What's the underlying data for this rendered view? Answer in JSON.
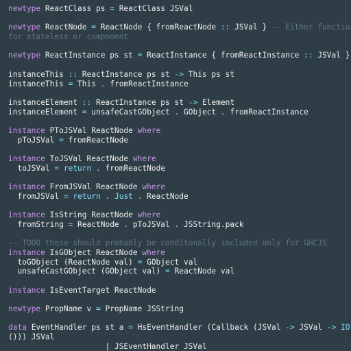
{
  "editor": {
    "colors": {
      "background": "#2f3e46",
      "keyword": "#c792ea",
      "operator": "#89ddff",
      "comment": "#5f7580",
      "text": "#eeeeee"
    },
    "lines": [
      [
        {
          "t": "newtype",
          "c": "kw"
        },
        {
          "t": " ReactClass ps ",
          "c": "tx"
        },
        {
          "t": "=",
          "c": "op"
        },
        {
          "t": " ReactClass JSVal",
          "c": "tx"
        }
      ],
      [],
      [
        {
          "t": "newtype",
          "c": "kw"
        },
        {
          "t": " ReactNode ",
          "c": "tx"
        },
        {
          "t": "=",
          "c": "op"
        },
        {
          "t": " ReactNode { fromReactNode ",
          "c": "tx"
        },
        {
          "t": "::",
          "c": "op"
        },
        {
          "t": " JSVal } ",
          "c": "tx"
        },
        {
          "t": "-- Either function",
          "c": "cm"
        }
      ],
      [
        {
          "t": "for stateless or component",
          "c": "cm"
        }
      ],
      [],
      [
        {
          "t": "newtype",
          "c": "kw"
        },
        {
          "t": " ReactInstance ps st ",
          "c": "tx"
        },
        {
          "t": "=",
          "c": "op"
        },
        {
          "t": " ReactInstance { fromReactInstance ",
          "c": "tx"
        },
        {
          "t": "::",
          "c": "op"
        },
        {
          "t": " JSVal }",
          "c": "tx"
        }
      ],
      [],
      [
        {
          "t": "instanceThis ",
          "c": "tx"
        },
        {
          "t": "::",
          "c": "op"
        },
        {
          "t": " ReactInstance ps st ",
          "c": "tx"
        },
        {
          "t": "->",
          "c": "op"
        },
        {
          "t": " This ps st",
          "c": "tx"
        }
      ],
      [
        {
          "t": "instanceThis ",
          "c": "tx"
        },
        {
          "t": "=",
          "c": "op"
        },
        {
          "t": " This ",
          "c": "tx"
        },
        {
          "t": ".",
          "c": "op"
        },
        {
          "t": " fromReactInstance",
          "c": "tx"
        }
      ],
      [],
      [
        {
          "t": "instanceElement ",
          "c": "tx"
        },
        {
          "t": "::",
          "c": "op"
        },
        {
          "t": " ReactInstance ps st ",
          "c": "tx"
        },
        {
          "t": "->",
          "c": "op"
        },
        {
          "t": " Element",
          "c": "tx"
        }
      ],
      [
        {
          "t": "instanceElement ",
          "c": "tx"
        },
        {
          "t": "=",
          "c": "op"
        },
        {
          "t": " unsafeCastGObject ",
          "c": "tx"
        },
        {
          "t": ".",
          "c": "op"
        },
        {
          "t": " GObject ",
          "c": "tx"
        },
        {
          "t": ".",
          "c": "op"
        },
        {
          "t": " fromReactInstance",
          "c": "tx"
        }
      ],
      [],
      [
        {
          "t": "instance",
          "c": "kw"
        },
        {
          "t": " PToJSVal ReactNode ",
          "c": "tx"
        },
        {
          "t": "where",
          "c": "kw"
        }
      ],
      [
        {
          "t": "  pToJSVal ",
          "c": "tx"
        },
        {
          "t": "=",
          "c": "op"
        },
        {
          "t": " fromReactNode",
          "c": "tx"
        }
      ],
      [],
      [
        {
          "t": "instance",
          "c": "kw"
        },
        {
          "t": " ToJSVal ReactNode ",
          "c": "tx"
        },
        {
          "t": "where",
          "c": "kw"
        }
      ],
      [
        {
          "t": "  toJSVal ",
          "c": "tx"
        },
        {
          "t": "=",
          "c": "op"
        },
        {
          "t": " return",
          "c": "op"
        },
        {
          "t": " ",
          "c": "tx"
        },
        {
          "t": ".",
          "c": "op"
        },
        {
          "t": " fromReactNode",
          "c": "tx"
        }
      ],
      [],
      [
        {
          "t": "instance",
          "c": "kw"
        },
        {
          "t": " FromJSVal ReactNode ",
          "c": "tx"
        },
        {
          "t": "where",
          "c": "kw"
        }
      ],
      [
        {
          "t": "  fromJSVal ",
          "c": "tx"
        },
        {
          "t": "=",
          "c": "op"
        },
        {
          "t": " return",
          "c": "op"
        },
        {
          "t": " ",
          "c": "tx"
        },
        {
          "t": ".",
          "c": "op"
        },
        {
          "t": " Just",
          "c": "op"
        },
        {
          "t": " ",
          "c": "tx"
        },
        {
          "t": ".",
          "c": "op"
        },
        {
          "t": " ReactNode",
          "c": "tx"
        }
      ],
      [],
      [
        {
          "t": "instance",
          "c": "kw"
        },
        {
          "t": " IsString ReactNode ",
          "c": "tx"
        },
        {
          "t": "where",
          "c": "kw"
        }
      ],
      [
        {
          "t": "  fromString ",
          "c": "tx"
        },
        {
          "t": "=",
          "c": "op"
        },
        {
          "t": " ReactNode ",
          "c": "tx"
        },
        {
          "t": ".",
          "c": "op"
        },
        {
          "t": " pToJSVal ",
          "c": "tx"
        },
        {
          "t": ".",
          "c": "op"
        },
        {
          "t": " JSString.pack",
          "c": "tx"
        }
      ],
      [],
      [
        {
          "t": "-- TODO these should probably be conditonally included only for GHCJS",
          "c": "cm"
        }
      ],
      [
        {
          "t": "instance",
          "c": "kw"
        },
        {
          "t": " IsGObject ReactNode ",
          "c": "tx"
        },
        {
          "t": "where",
          "c": "kw"
        }
      ],
      [
        {
          "t": "  toGObject (ReactNode val) ",
          "c": "tx"
        },
        {
          "t": "=",
          "c": "op"
        },
        {
          "t": " GObject val",
          "c": "tx"
        }
      ],
      [
        {
          "t": "  unsafeCastGObject (GObject val) ",
          "c": "tx"
        },
        {
          "t": "=",
          "c": "op"
        },
        {
          "t": " ReactNode val",
          "c": "tx"
        }
      ],
      [],
      [
        {
          "t": "instance",
          "c": "kw"
        },
        {
          "t": " IsEventTarget ReactNode",
          "c": "tx"
        }
      ],
      [],
      [
        {
          "t": "newtype",
          "c": "kw"
        },
        {
          "t": " PropName v ",
          "c": "tx"
        },
        {
          "t": "=",
          "c": "op"
        },
        {
          "t": " PropName JSString",
          "c": "tx"
        }
      ],
      [],
      [
        {
          "t": "data",
          "c": "kw"
        },
        {
          "t": " EventHandler ps st a ",
          "c": "tx"
        },
        {
          "t": "=",
          "c": "op"
        },
        {
          "t": " HsEventHandler (Callback (JSVal ",
          "c": "tx"
        },
        {
          "t": "->",
          "c": "op"
        },
        {
          "t": " JSVal ",
          "c": "tx"
        },
        {
          "t": "->",
          "c": "op"
        },
        {
          "t": " IO",
          "c": "op"
        }
      ],
      [
        {
          "t": "())) JSVal",
          "c": "tx"
        }
      ],
      [
        {
          "t": "                     | JSEventHandler JSVal",
          "c": "tx"
        }
      ]
    ]
  }
}
